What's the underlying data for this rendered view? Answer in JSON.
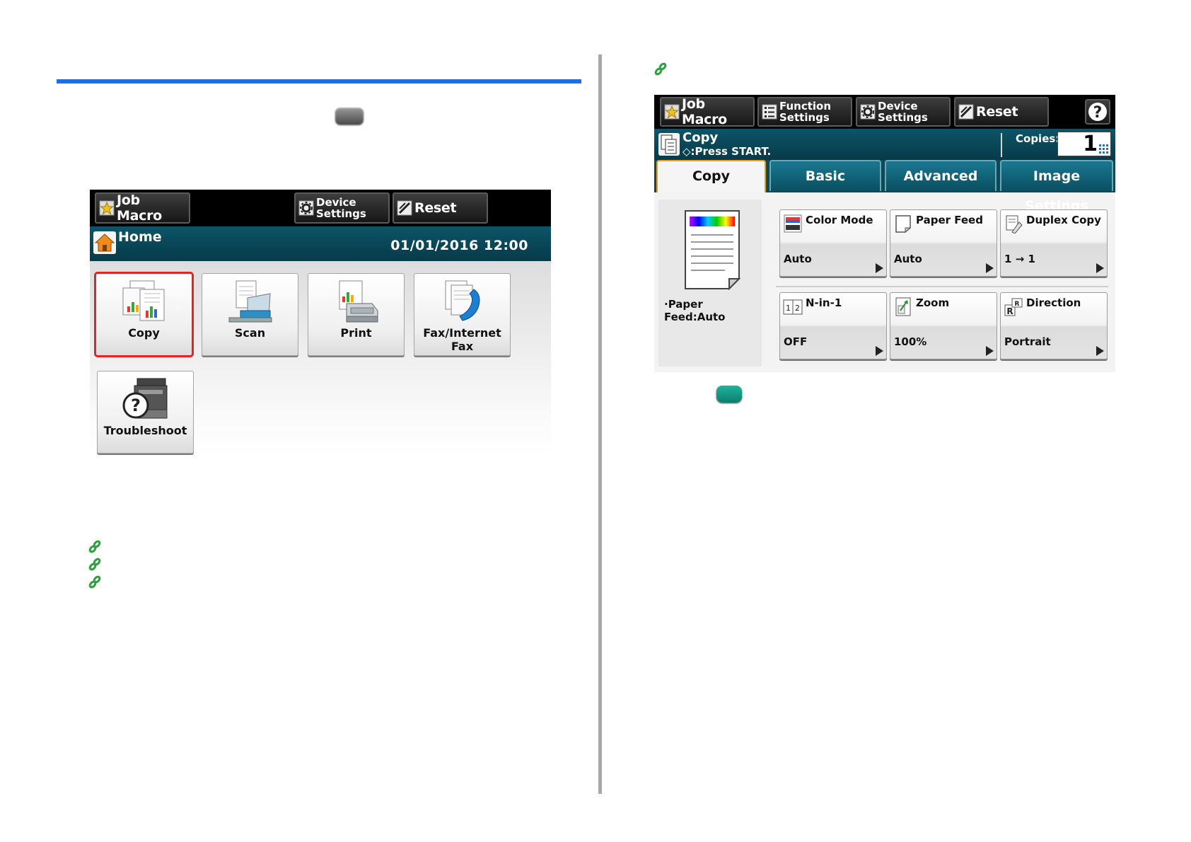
{
  "home_panel": {
    "toolbar": {
      "job_macro": "Job Macro",
      "device_settings_line1": "Device",
      "device_settings_line2": "Settings",
      "reset": "Reset"
    },
    "status": {
      "title": "Home",
      "datetime": "01/01/2016 12:00"
    },
    "apps": [
      {
        "label": "Copy",
        "selected": true
      },
      {
        "label": "Scan",
        "selected": false
      },
      {
        "label": "Print",
        "selected": false
      },
      {
        "label": "Fax/Internet Fax",
        "selected": false
      },
      {
        "label": "Troubleshoot",
        "selected": false
      }
    ]
  },
  "copy_panel": {
    "toolbar": {
      "job_macro": "Job Macro",
      "function_settings_line1": "Function",
      "function_settings_line2": "Settings",
      "device_settings_line1": "Device",
      "device_settings_line2": "Settings",
      "reset": "Reset",
      "help_icon": "question-icon"
    },
    "status": {
      "title": "Copy",
      "subtitle": "◇:Press START.",
      "copies_label": "Copies:",
      "copies_value": "1"
    },
    "tabs": [
      {
        "label": "Copy",
        "active": true
      },
      {
        "label": "Basic",
        "active": false
      },
      {
        "label": "Advanced",
        "active": false
      },
      {
        "label": "Image Settings",
        "active": false
      }
    ],
    "preview": {
      "label": "·Paper Feed:Auto"
    },
    "features": [
      {
        "name": "Color Mode",
        "value": "Auto",
        "icon": "color-mode-icon"
      },
      {
        "name": "Paper Feed",
        "value": "Auto",
        "icon": "paper-feed-icon"
      },
      {
        "name": "Duplex Copy",
        "value": "1 → 1",
        "icon": "duplex-copy-icon"
      },
      {
        "name": "N-in-1",
        "value": "OFF",
        "icon": "n-in-1-icon"
      },
      {
        "name": "Zoom",
        "value": "100%",
        "icon": "zoom-icon"
      },
      {
        "name": "Direction",
        "value": "Portrait",
        "icon": "direction-icon"
      }
    ]
  },
  "colors": {
    "accent_rule": "#1e6fe0",
    "link_icon": "#2aa13a",
    "selection_outline": "#e32424",
    "status_bar": "#0c5569",
    "start_key": "#12a08a"
  }
}
